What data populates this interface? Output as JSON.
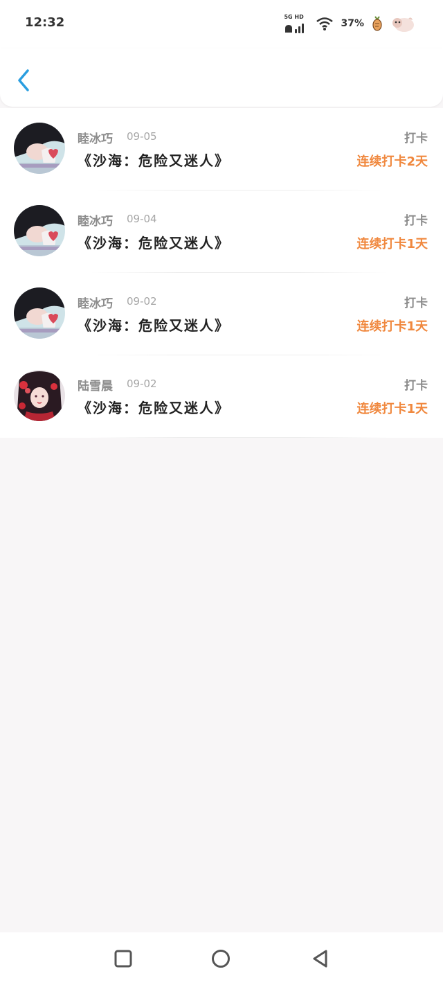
{
  "status_bar": {
    "time": "12:32",
    "network": "5G HD",
    "battery": "37%"
  },
  "header": {
    "back_icon": "chevron-left-icon",
    "accent_color": "#2a9ee0"
  },
  "checkins": [
    {
      "name": "睦冰巧",
      "date": "09-05",
      "title": "《沙海：危险又迷人》",
      "type": "打卡",
      "streak": "连续打卡2天"
    },
    {
      "name": "睦冰巧",
      "date": "09-04",
      "title": "《沙海：危险又迷人》",
      "type": "打卡",
      "streak": "连续打卡1天"
    },
    {
      "name": "睦冰巧",
      "date": "09-02",
      "title": "《沙海：危险又迷人》",
      "type": "打卡",
      "streak": "连续打卡1天"
    },
    {
      "name": "陆雪晨",
      "date": "09-02",
      "title": "《沙海：危险又迷人》",
      "type": "打卡",
      "streak": "连续打卡1天"
    }
  ],
  "colors": {
    "streak": "#f0883e",
    "background": "#f8f6f7"
  },
  "nav": {
    "recent_icon": "square-icon",
    "home_icon": "circle-icon",
    "back_icon": "triangle-back-icon"
  }
}
